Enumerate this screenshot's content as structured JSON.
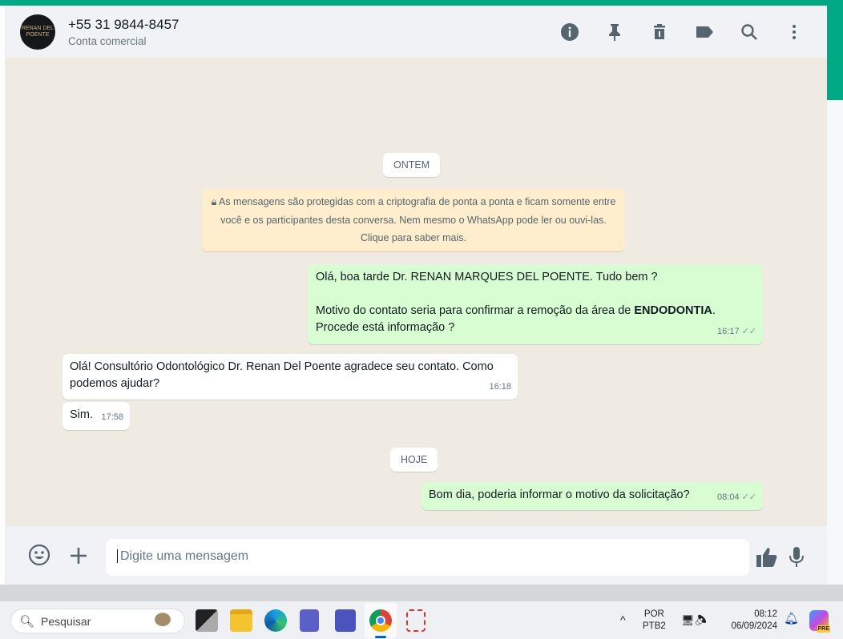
{
  "header": {
    "contact": "+55 31 9844-8457",
    "subtitle": "Conta comercial",
    "avatar_text": "RENAN DEL POENTE"
  },
  "header_icons": [
    "info-icon",
    "pin-icon",
    "delete-icon",
    "label-icon",
    "search-icon",
    "more-icon"
  ],
  "chat": {
    "date_yesterday": "ONTEM",
    "encryption_notice": "As mensagens são protegidas com a criptografia de ponta a ponta e ficam somente entre você e os participantes desta conversa. Nem mesmo o WhatsApp pode ler ou ouvi-las. Clique para saber mais.",
    "messages": [
      {
        "dir": "out",
        "line1": "Olá, boa tarde Dr. RENAN MARQUES DEL POENTE. Tudo bem ?",
        "line2_pre": "Motivo do contato seria para confirmar a remoção da área de ",
        "line2_bold": "ENDODONTIA",
        "line2_post": ".",
        "line3": "Procede está informação ?",
        "time": "16:17"
      },
      {
        "dir": "in",
        "text": "Olá! Consultório Odontológico Dr. Renan Del Poente agradece seu contato. Como podemos ajudar?",
        "time": "16:18"
      },
      {
        "dir": "in",
        "text": "Sim.",
        "time": "17:58"
      },
      {
        "dir": "out",
        "text": "Bom dia, poderia informar o motivo da solicitação?",
        "time": "08:04"
      }
    ],
    "date_today": "HOJE"
  },
  "composer": {
    "placeholder": "Digite uma mensagem"
  },
  "taskbar": {
    "search": "Pesquisar",
    "lang1": "POR",
    "lang2": "PTB2",
    "time": "08:12",
    "date": "06/09/2024",
    "copilot_badge": "PRE"
  }
}
